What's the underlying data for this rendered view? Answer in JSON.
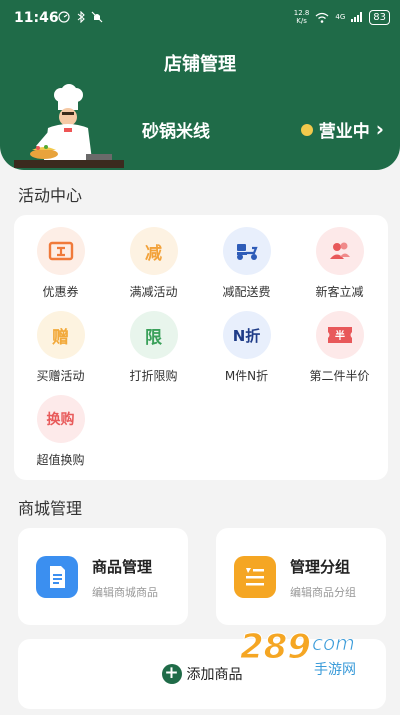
{
  "status_bar": {
    "time": "11:46",
    "net_speed_value": "12.8",
    "net_speed_unit": "K/s",
    "network": "4G",
    "battery": "83"
  },
  "header": {
    "title": "店铺管理",
    "store_name": "砂锅米线",
    "status_label": "营业中",
    "status_color": "#f2c94c",
    "brand_color": "#1f6b48"
  },
  "activity": {
    "title": "活动中心",
    "items": [
      {
        "label": "优惠券",
        "glyph": "",
        "icon": "coupon-icon",
        "bg": "#fdeee6",
        "fg": "#f07a3a"
      },
      {
        "label": "满减活动",
        "glyph": "减",
        "icon": "discount-icon",
        "bg": "#fdf2e2",
        "fg": "#f2a23a"
      },
      {
        "label": "减配送费",
        "glyph": "",
        "icon": "delivery-scooter-icon",
        "bg": "#e8effc",
        "fg": "#2e5cb8"
      },
      {
        "label": "新客立减",
        "glyph": "",
        "icon": "new-customer-icon",
        "bg": "#fde9e9",
        "fg": "#e8585a"
      },
      {
        "label": "买赠活动",
        "glyph": "赠",
        "icon": "gift-icon",
        "bg": "#fdf3e0",
        "fg": "#f2a93a"
      },
      {
        "label": "打折限购",
        "glyph": "限",
        "icon": "limit-icon",
        "bg": "#e8f5ec",
        "fg": "#3aa05a"
      },
      {
        "label": "M件N折",
        "glyph": "N折",
        "icon": "mn-discount-icon",
        "bg": "#e8effc",
        "fg": "#1f3c88"
      },
      {
        "label": "第二件半价",
        "glyph": "半",
        "icon": "half-price-icon",
        "bg": "#fde9e9",
        "fg": "#e8585a"
      },
      {
        "label": "超值换购",
        "glyph": "换购",
        "icon": "exchange-icon",
        "bg": "#fdeaea",
        "fg": "#e85a5a"
      }
    ]
  },
  "mall": {
    "title": "商城管理",
    "cards": [
      {
        "title": "商品管理",
        "subtitle": "编辑商城商品",
        "icon": "document-icon",
        "color": "#3b8ff0"
      },
      {
        "title": "管理分组",
        "subtitle": "编辑商品分组",
        "icon": "group-list-icon",
        "color": "#f5a623"
      }
    ],
    "add_label": "添加商品"
  },
  "watermark": {
    "main": "289",
    "suffix": "com",
    "sub": "手游网"
  }
}
